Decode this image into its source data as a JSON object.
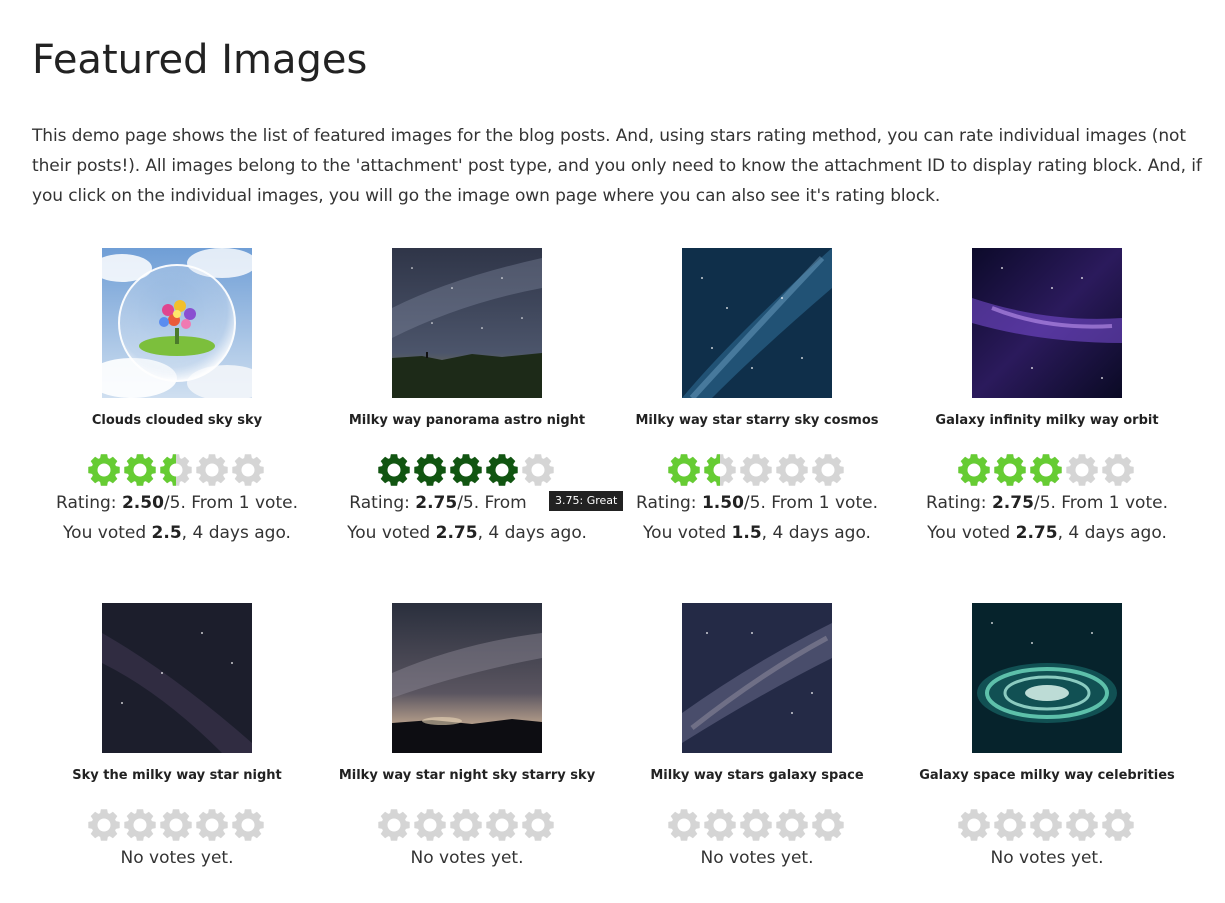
{
  "page": {
    "title": "Featured Images",
    "intro": "This demo page shows the list of featured images for the blog posts. And, using stars rating method, you can rate individual images (not their posts!). All images belong to the 'attachment' post type, and you only need to know the attachment ID to display rating block. And, if you click on the individual images, you will go the image own page where you can also see it's rating block."
  },
  "colors": {
    "star_empty": "#d5d5d5",
    "star_voted": "#66cc33",
    "star_hover": "#115511"
  },
  "rating_labels": {
    "rating_prefix": "Rating: ",
    "rating_suffix": "/5. From 1 vote.",
    "rating_suffix_hover": "/5. From",
    "voted_prefix": "You voted ",
    "voted_suffix": ", 4 days ago.",
    "no_votes": "No votes yet."
  },
  "items": [
    {
      "title": "Clouds clouded sky sky",
      "image": "clouds-bubble-flower",
      "rating": "2.50",
      "rating_value": 2.5,
      "voted": "2.5",
      "hover": false
    },
    {
      "title": "Milky way panorama astro night",
      "image": "milky-way-panorama",
      "rating": "2.75",
      "rating_value": 4,
      "voted": "2.75",
      "hover": true,
      "tooltip": "3.75: Great"
    },
    {
      "title": "Milky way star starry sky cosmos",
      "image": "blue-starry-sky",
      "rating": "1.50",
      "rating_value": 1.5,
      "voted": "1.5",
      "hover": false
    },
    {
      "title": "Galaxy infinity milky way orbit",
      "image": "purple-galaxy",
      "rating": "2.75",
      "rating_value": 3,
      "voted": "2.75",
      "hover": false
    },
    {
      "title": "Sky the milky way star night",
      "image": "dark-milky-way",
      "rating_value": 0,
      "novotes": true
    },
    {
      "title": "Milky way star night sky starry sky",
      "image": "milky-way-horizon",
      "rating_value": 0,
      "novotes": true
    },
    {
      "title": "Milky way stars galaxy space",
      "image": "milky-way-stars",
      "rating_value": 0,
      "novotes": true
    },
    {
      "title": "Galaxy space milky way celebrities",
      "image": "spiral-galaxy",
      "rating_value": 0,
      "novotes": true
    }
  ]
}
